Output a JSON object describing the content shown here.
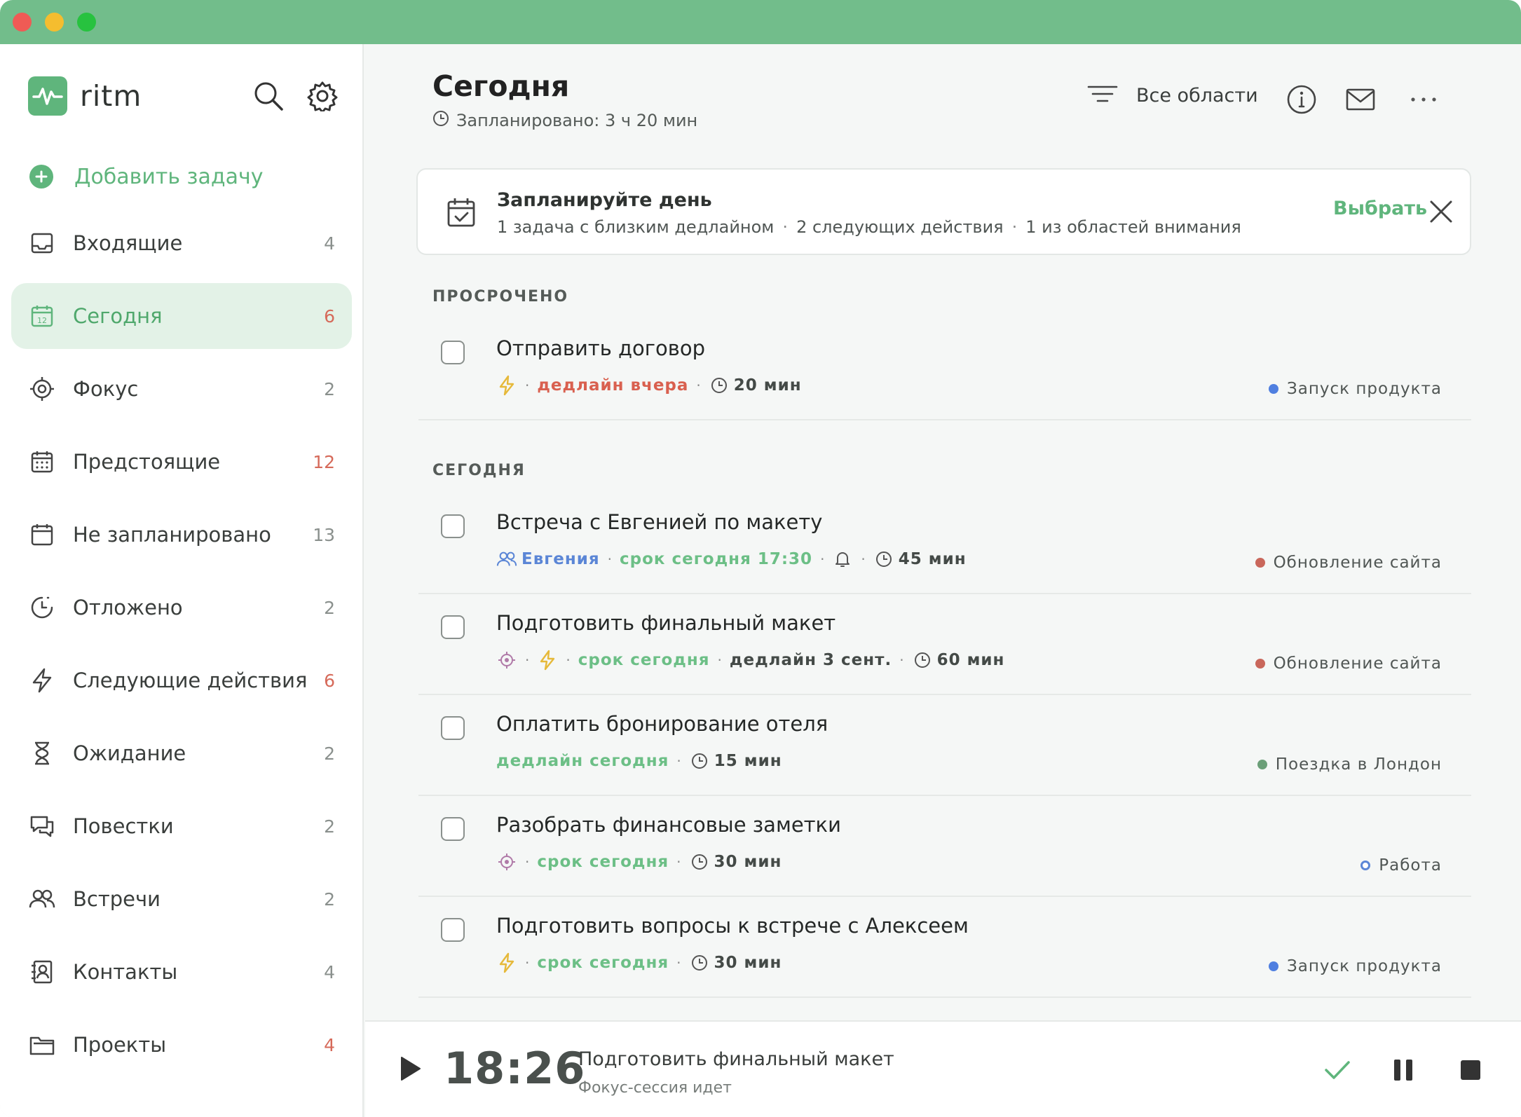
{
  "app": {
    "name": "ritm"
  },
  "sidebar": {
    "add_task_label": "Добавить задачу",
    "items": [
      {
        "label": "Входящие",
        "count": "4",
        "icon": "inbox-icon"
      },
      {
        "label": "Сегодня",
        "count": "6",
        "icon": "calendar-today-icon",
        "active": true
      },
      {
        "label": "Фокус",
        "count": "2",
        "icon": "target-icon"
      },
      {
        "label": "Предстоящие",
        "count": "12",
        "icon": "calendar-grid-icon"
      },
      {
        "label": "Не запланировано",
        "count": "13",
        "icon": "calendar-empty-icon"
      },
      {
        "label": "Отложено",
        "count": "2",
        "icon": "snooze-icon"
      },
      {
        "label": "Следующие действия",
        "count": "6",
        "icon": "bolt-icon"
      },
      {
        "label": "Ожидание",
        "count": "2",
        "icon": "hourglass-icon"
      },
      {
        "label": "Повестки",
        "count": "2",
        "icon": "chat-icon"
      },
      {
        "label": "Встречи",
        "count": "2",
        "icon": "people-icon"
      },
      {
        "label": "Контакты",
        "count": "4",
        "icon": "contact-card-icon"
      },
      {
        "label": "Проекты",
        "count": "4",
        "icon": "folder-icon"
      }
    ]
  },
  "header": {
    "title": "Сегодня",
    "subtitle": "Запланировано: 3 ч 20 мин",
    "filter_label": "Все области"
  },
  "banner": {
    "title": "Запланируйте день",
    "parts": [
      "1 задача с близким дедлайном",
      "2 следующих действия",
      "1 из областей внимания"
    ],
    "separator": "·",
    "action": "Выбрать"
  },
  "sections": {
    "overdue": "ПРОСРОЧЕНО",
    "today": "СЕГОДНЯ"
  },
  "tasks": [
    {
      "title": "Отправить договор",
      "meta": {
        "deadline": "дедлайн вчера",
        "duration": "20 мин"
      },
      "area": "Запуск продукта"
    },
    {
      "title": "Встреча с Евгенией по макету",
      "meta": {
        "person": "Евгения",
        "due": "срок сегодня 17:30",
        "duration": "45 мин"
      },
      "area": "Обновление сайта"
    },
    {
      "title": "Подготовить финальный макет",
      "meta": {
        "due": "срок сегодня",
        "deadline": "дедлайн 3 сент.",
        "duration": "60 мин"
      },
      "area": "Обновление сайта"
    },
    {
      "title": "Оплатить бронирование отеля",
      "meta": {
        "deadline": "дедлайн сегодня",
        "duration": "15 мин"
      },
      "area": "Поездка в Лондон"
    },
    {
      "title": "Разобрать финансовые заметки",
      "meta": {
        "due": "срок сегодня",
        "duration": "30 мин"
      },
      "area": "Работа"
    },
    {
      "title": "Подготовить вопросы к встрече с Алексеем",
      "meta": {
        "due": "срок сегодня",
        "duration": "30 мин"
      },
      "area": "Запуск продукта"
    }
  ],
  "area_colors": {
    "Запуск продукта": "#4f7fe0",
    "Обновление сайта": "#c9675b",
    "Поездка в Лондон": "#6b9f78",
    "Работа": "#5b86d6"
  },
  "player": {
    "time": "18:26",
    "task": "Подготовить финальный макет",
    "status": "Фокус-сессия идет"
  }
}
